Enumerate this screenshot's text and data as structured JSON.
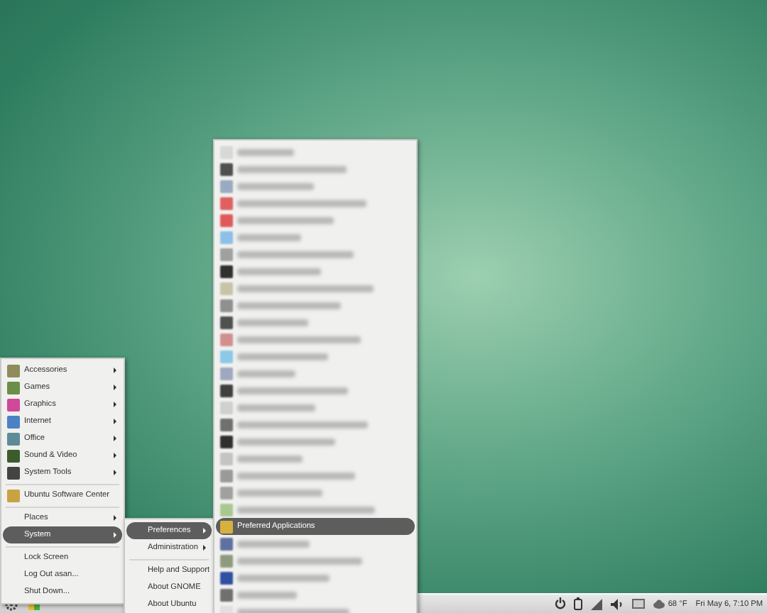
{
  "main_menu": {
    "items": [
      {
        "kind": "item",
        "label": "Accessories",
        "color": "#8f8c5c",
        "submenu": true,
        "selected": false
      },
      {
        "kind": "item",
        "label": "Games",
        "color": "#6b8f4a",
        "submenu": true,
        "selected": false
      },
      {
        "kind": "item",
        "label": "Graphics",
        "color": "#d0489a",
        "submenu": true,
        "selected": false
      },
      {
        "kind": "item",
        "label": "Internet",
        "color": "#4c82c4",
        "submenu": true,
        "selected": false
      },
      {
        "kind": "item",
        "label": "Office",
        "color": "#5d8c98",
        "submenu": true,
        "selected": false
      },
      {
        "kind": "item",
        "label": "Sound & Video",
        "color": "#3d5c2c",
        "submenu": true,
        "selected": false
      },
      {
        "kind": "item",
        "label": "System Tools",
        "color": "#444444",
        "submenu": true,
        "selected": false
      },
      {
        "kind": "separator"
      },
      {
        "kind": "item",
        "label": "Ubuntu Software Center",
        "color": "#c9a244",
        "submenu": false,
        "selected": false
      },
      {
        "kind": "separator"
      },
      {
        "kind": "item",
        "label": "Places",
        "submenu": true,
        "selected": false
      },
      {
        "kind": "item",
        "label": "System",
        "submenu": true,
        "selected": true
      },
      {
        "kind": "separator"
      },
      {
        "kind": "item",
        "label": "Lock Screen",
        "submenu": false,
        "selected": false
      },
      {
        "kind": "item",
        "label": "Log Out asan...",
        "submenu": false,
        "selected": false
      },
      {
        "kind": "item",
        "label": "Shut Down...",
        "submenu": false,
        "selected": false
      }
    ]
  },
  "system_menu": {
    "items": [
      {
        "kind": "item",
        "label": "Preferences",
        "submenu": true,
        "selected": true
      },
      {
        "kind": "item",
        "label": "Administration",
        "submenu": true,
        "selected": false
      },
      {
        "kind": "separator"
      },
      {
        "kind": "item",
        "label": "Help and Support",
        "submenu": false,
        "selected": false
      },
      {
        "kind": "item",
        "label": "About GNOME",
        "submenu": false,
        "selected": false
      },
      {
        "kind": "item",
        "label": "About Ubuntu",
        "submenu": false,
        "selected": false
      }
    ]
  },
  "preferences_menu": {
    "items": [
      {
        "kind": "blurred",
        "color": "#d8d8d8"
      },
      {
        "kind": "blurred",
        "color": "#505050"
      },
      {
        "kind": "blurred",
        "color": "#9aaac0"
      },
      {
        "kind": "blurred",
        "color": "#e06060"
      },
      {
        "kind": "blurred",
        "color": "#e05a5a"
      },
      {
        "kind": "blurred",
        "color": "#8cc0e8"
      },
      {
        "kind": "blurred",
        "color": "#a0a0a0"
      },
      {
        "kind": "blurred",
        "color": "#303030"
      },
      {
        "kind": "blurred",
        "color": "#c8c4a8"
      },
      {
        "kind": "blurred",
        "color": "#909090"
      },
      {
        "kind": "blurred",
        "color": "#505050"
      },
      {
        "kind": "blurred",
        "color": "#d09090"
      },
      {
        "kind": "blurred",
        "color": "#8cc8e8"
      },
      {
        "kind": "blurred",
        "color": "#a0a8c0"
      },
      {
        "kind": "blurred",
        "color": "#404040"
      },
      {
        "kind": "blurred",
        "color": "#d0d0d0"
      },
      {
        "kind": "blurred",
        "color": "#707070"
      },
      {
        "kind": "blurred",
        "color": "#303030"
      },
      {
        "kind": "blurred",
        "color": "#c4c4c4"
      },
      {
        "kind": "blurred",
        "color": "#9a9a9a"
      },
      {
        "kind": "blurred",
        "color": "#a0a0a0"
      },
      {
        "kind": "blurred",
        "color": "#a8c890"
      },
      {
        "kind": "item",
        "label": "Preferred Applications",
        "color": "#d8b040",
        "submenu": false,
        "selected": true
      },
      {
        "kind": "blurred",
        "color": "#6070a0"
      },
      {
        "kind": "blurred",
        "color": "#909a80"
      },
      {
        "kind": "blurred",
        "color": "#3050a0"
      },
      {
        "kind": "blurred",
        "color": "#707070"
      },
      {
        "kind": "blurred",
        "color": "#e0e0e0"
      }
    ]
  },
  "taskbar": {
    "weather": "68 °F",
    "clock": "Fri May 6, 7:10 PM"
  }
}
